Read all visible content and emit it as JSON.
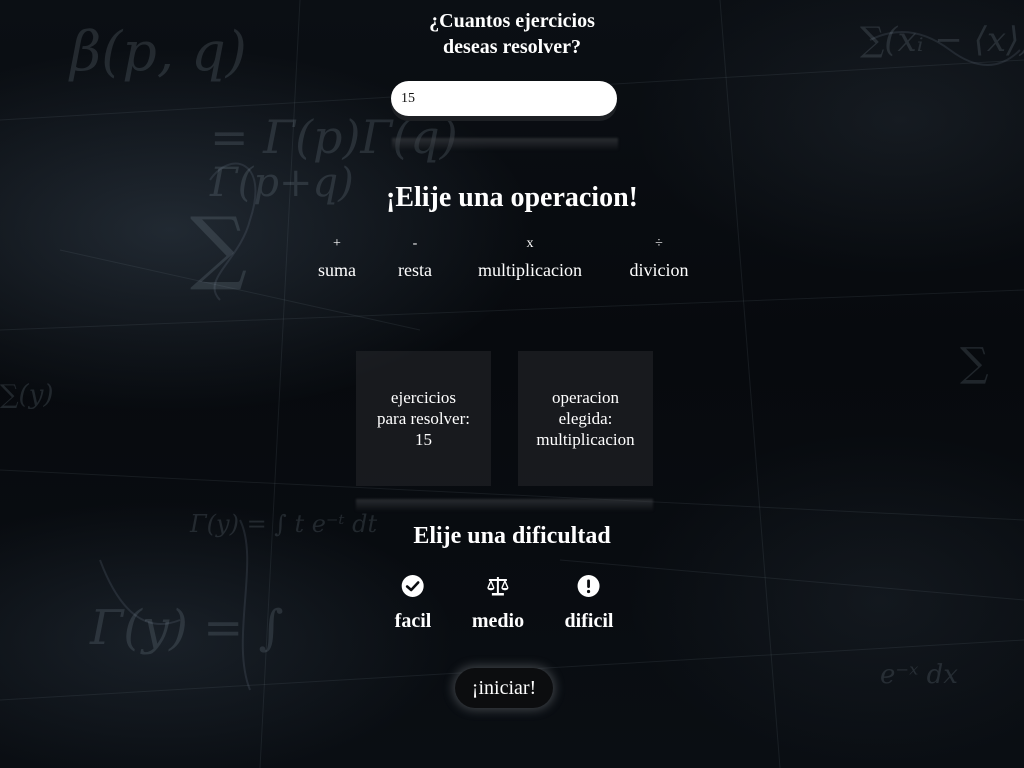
{
  "count_section": {
    "question_line1": "¿Cuantos ejercicios",
    "question_line2": "deseas resolver?",
    "input_value": "15"
  },
  "operation_section": {
    "title": "¡Elije una operacion!",
    "operations": [
      {
        "symbol": "+",
        "label": "suma"
      },
      {
        "symbol": "-",
        "label": "resta"
      },
      {
        "symbol": "x",
        "label": "multiplicacion"
      },
      {
        "symbol": "÷",
        "label": "divicion"
      }
    ]
  },
  "summary": {
    "exercises_line1": "ejercicios",
    "exercises_line2": "para resolver:",
    "exercises_value": "15",
    "operation_line1": "operacion",
    "operation_line2": "elegida:",
    "operation_value": "multiplicacion"
  },
  "difficulty_section": {
    "title": "Elije una dificultad",
    "levels": [
      {
        "label": "facil",
        "icon": "check-circle-icon"
      },
      {
        "label": "medio",
        "icon": "balance-scale-icon"
      },
      {
        "label": "dificil",
        "icon": "exclamation-circle-icon"
      }
    ]
  },
  "start_button": {
    "label": "¡iniciar!"
  },
  "colors": {
    "background": "#07090c",
    "text": "#ffffff",
    "card": "#26282b",
    "button": "#0c0d0f"
  }
}
